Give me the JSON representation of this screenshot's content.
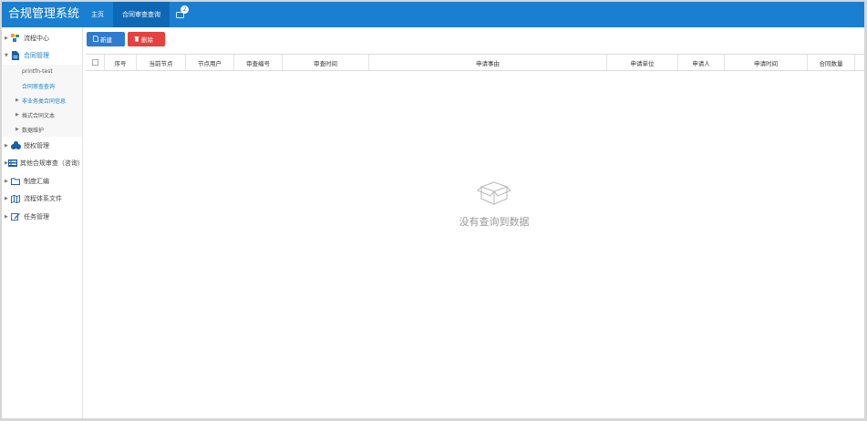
{
  "app": {
    "title": "合规管理系统"
  },
  "header": {
    "nav": [
      "主页",
      "合同审查查询"
    ],
    "active_index": 1,
    "message_badge": "2"
  },
  "sidebar": {
    "items": [
      {
        "label": "流程中心",
        "icon": "flow-icon"
      },
      {
        "label": "合同管理",
        "icon": "document-icon",
        "open": true
      },
      {
        "label": "授权管理",
        "icon": "authorization-icon"
      },
      {
        "label": "其他合规审查（咨询）",
        "icon": "list-icon"
      },
      {
        "label": "制度汇编",
        "icon": "folder-icon"
      },
      {
        "label": "流程体系文件",
        "icon": "map-icon"
      },
      {
        "label": "任务管理",
        "icon": "edit-icon"
      }
    ],
    "contract_submenu": [
      {
        "label": "printfn-test",
        "type": "leaf"
      },
      {
        "label": "合同审查查询",
        "type": "leaf",
        "active": true
      },
      {
        "label": "非业务类合同信息",
        "type": "group"
      },
      {
        "label": "格式合同文本",
        "type": "group"
      },
      {
        "label": "数据维护",
        "type": "group"
      }
    ]
  },
  "toolbar": {
    "new_label": "新建",
    "delete_label": "删除"
  },
  "table": {
    "columns": [
      "序号",
      "当前节点",
      "节点用户",
      "审查编号",
      "审查时间",
      "申请事由",
      "申请单位",
      "申请人",
      "申请时间",
      "合同数量"
    ],
    "rows": []
  },
  "empty_state": {
    "text": "没有查询到数据",
    "icon": "empty-box-icon"
  },
  "colors": {
    "header": "#1a7fd0",
    "header_active": "#0f68b5",
    "new_button": "#2e7bcf",
    "delete_button": "#e5413f"
  }
}
